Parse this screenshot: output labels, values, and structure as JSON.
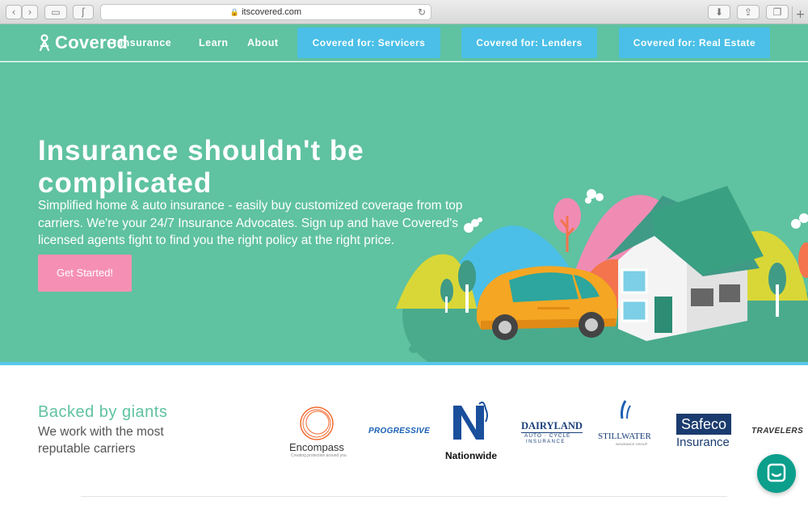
{
  "browser": {
    "url": "itscovered.com"
  },
  "header": {
    "logo_text": "Covered",
    "nav": [
      {
        "label": "t Insurance"
      },
      {
        "label": "Learn"
      },
      {
        "label": "About"
      }
    ],
    "ctas": [
      {
        "label": "Covered for: Servicers"
      },
      {
        "label": "Covered for: Lenders"
      },
      {
        "label": "Covered for: Real Estate"
      }
    ]
  },
  "hero": {
    "title": "Insurance shouldn't be complicated",
    "subtitle": "Simplified home & auto insurance - easily buy customized coverage from top carriers. We're your 24/7 Insurance Advocates. Sign up and have Covered's licensed agents fight to find you the right policy at the right price.",
    "button_label": "Get Started!"
  },
  "carriers": {
    "title": "Backed by giants",
    "subtitle": "We work with the most reputable carriers",
    "logos": [
      {
        "name": "Encompass",
        "tagline": "Creating protection around you"
      },
      {
        "name": "PROGRESSIVE"
      },
      {
        "name": "Nationwide"
      },
      {
        "name": "DAIRYLAND",
        "line2": "AUTO · CYCLE",
        "line3": "INSURANCE"
      },
      {
        "name": "STILLWATER",
        "line2": "INSURANCE GROUP"
      },
      {
        "name": "Safeco",
        "line2": "Insurance"
      },
      {
        "name": "TRAVELERS"
      }
    ]
  },
  "colors": {
    "brand_green": "#5fc2a0",
    "cta_blue": "#4bbfe7",
    "button_pink": "#f590b4",
    "chat_teal": "#0b9f8c"
  }
}
